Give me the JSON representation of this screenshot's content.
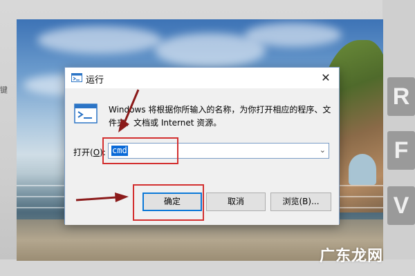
{
  "left_edge_text": "键盘",
  "right_keys": [
    "R",
    "F",
    "V"
  ],
  "dialog": {
    "title": "运行",
    "close_glyph": "✕",
    "description": "Windows 将根据你所输入的名称，为你打开相应的程序、文件夹、文档或 Internet 资源。",
    "open_label_prefix": "打开(",
    "open_label_key": "O",
    "open_label_suffix": "):",
    "combo_value": "cmd",
    "combo_dropdown_glyph": "⌄",
    "buttons": {
      "ok": "确定",
      "cancel": "取消",
      "browse": "浏览(B)..."
    }
  },
  "annotation_color": "#d32f2f",
  "accent_color": "#0a78d7",
  "watermark": "广东龙网"
}
